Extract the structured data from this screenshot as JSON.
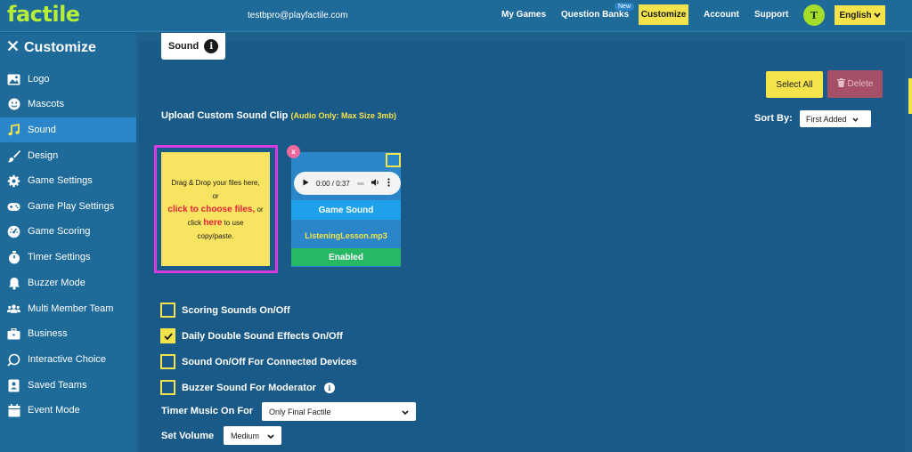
{
  "header": {
    "logo": "factile",
    "email": "testbpro@playfactile.com",
    "nav": [
      {
        "label": "My Games"
      },
      {
        "label": "Question Banks",
        "badge": "New"
      },
      {
        "label": "Customize"
      },
      {
        "label": "Account"
      },
      {
        "label": "Support"
      }
    ],
    "avatar_initial": "T",
    "language": "English"
  },
  "sidebar": {
    "title": "Customize",
    "items": [
      {
        "label": "Logo",
        "icon": "image-icon"
      },
      {
        "label": "Mascots",
        "icon": "smiley-icon"
      },
      {
        "label": "Sound",
        "icon": "music-note-icon",
        "active": true
      },
      {
        "label": "Design",
        "icon": "paintbrush-icon"
      },
      {
        "label": "Game Settings",
        "icon": "gear-icon"
      },
      {
        "label": "Game Play Settings",
        "icon": "gamepad-icon"
      },
      {
        "label": "Game Scoring",
        "icon": "gauge-icon"
      },
      {
        "label": "Timer Settings",
        "icon": "stopwatch-icon"
      },
      {
        "label": "Buzzer Mode",
        "icon": "bell-icon"
      },
      {
        "label": "Multi Member Team",
        "icon": "users-icon"
      },
      {
        "label": "Business",
        "icon": "briefcase-icon"
      },
      {
        "label": "Interactive Choice",
        "icon": "interactive-icon"
      },
      {
        "label": "Saved Teams",
        "icon": "id-card-icon"
      },
      {
        "label": "Event Mode",
        "icon": "calendar-icon"
      }
    ]
  },
  "main": {
    "tab_label": "Sound",
    "select_all": "Select All",
    "delete": "Delete",
    "upload_label": "Upload Custom Sound Clip",
    "upload_hint": "(Audio Only: Max Size 3mb)",
    "sort_label": "Sort By:",
    "sort_value": "First Added",
    "dropzone": {
      "line1": "Drag & Drop your files here,",
      "line2": "or",
      "link1": "click to choose files,",
      "line3": " or",
      "line4": "click ",
      "link2": "here",
      "line5": " to use",
      "line6": "copy/paste."
    },
    "card": {
      "close": "x",
      "time": "0:00 / 0:37",
      "type": "Game Sound",
      "file": "ListeningLesson.mp3",
      "status": "Enabled"
    },
    "options": [
      {
        "label": "Scoring Sounds On/Off",
        "checked": false
      },
      {
        "label": "Daily Double Sound Effects On/Off",
        "checked": true
      },
      {
        "label": "Sound On/Off For Connected Devices",
        "checked": false
      },
      {
        "label": "Buzzer Sound For Moderator",
        "checked": false,
        "info": true
      }
    ],
    "timer_music_label": "Timer Music On For",
    "timer_music_value": "Only Final Factile",
    "volume_label": "Set Volume",
    "volume_value": "Medium"
  }
}
